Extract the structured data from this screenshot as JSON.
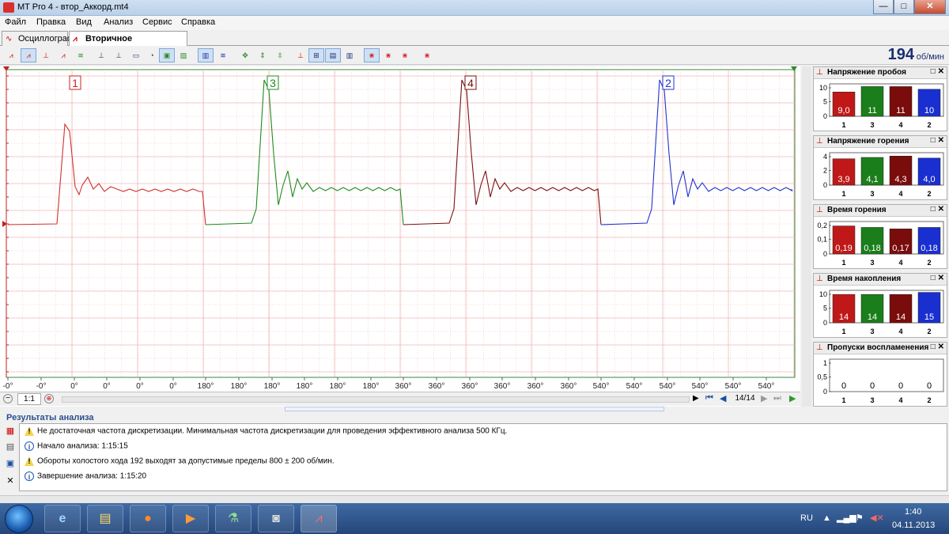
{
  "window": {
    "title": "MT Pro 4 - втор_Аккорд.mt4",
    "min": "—",
    "max": "□",
    "close": "✕"
  },
  "menu": [
    "Файл",
    "Правка",
    "Вид",
    "Анализ",
    "Сервис",
    "Справка"
  ],
  "tabs": [
    {
      "label": "Осциллограф",
      "icon": "oscilloscope-icon"
    },
    {
      "label": "Вторичное напряжение",
      "icon": "secondary-voltage-icon"
    }
  ],
  "rpm": {
    "value": "194",
    "unit": "об/мин"
  },
  "plot": {
    "cylinder_labels": [
      {
        "text": "1",
        "color": "#cc2222"
      },
      {
        "text": "3",
        "color": "#1f8a1f"
      },
      {
        "text": "4",
        "color": "#7a1010"
      },
      {
        "text": "2",
        "color": "#2233cc"
      }
    ],
    "x_ticks": [
      "-0°",
      "-0°",
      "0°",
      "0°",
      "0°",
      "0°",
      "180°",
      "180°",
      "180°",
      "180°",
      "180°",
      "180°",
      "360°",
      "360°",
      "360°",
      "360°",
      "360°",
      "360°",
      "540°",
      "540°",
      "540°",
      "540°",
      "540°",
      "540°"
    ],
    "zoom": "1:1",
    "page": "14/14"
  },
  "panels": [
    {
      "title": "Напряжение пробоя",
      "yticks": [
        "10",
        "5",
        "0"
      ],
      "ymax": 12,
      "bars": [
        {
          "cyl": "1",
          "value": 9.0,
          "label": "9,0",
          "color": "#c01818"
        },
        {
          "cyl": "3",
          "value": 11,
          "label": "11",
          "color": "#1a7f1a"
        },
        {
          "cyl": "4",
          "value": 11,
          "label": "11",
          "color": "#7a0c0c"
        },
        {
          "cyl": "2",
          "value": 10,
          "label": "10",
          "color": "#1a2fd0"
        }
      ]
    },
    {
      "title": "Напряжение горения",
      "yticks": [
        "4",
        "2",
        "0"
      ],
      "ymax": 4.8,
      "bars": [
        {
          "cyl": "1",
          "value": 3.9,
          "label": "3,9",
          "color": "#c01818"
        },
        {
          "cyl": "3",
          "value": 4.1,
          "label": "4,1",
          "color": "#1a7f1a"
        },
        {
          "cyl": "4",
          "value": 4.3,
          "label": "4,3",
          "color": "#7a0c0c"
        },
        {
          "cyl": "2",
          "value": 4.0,
          "label": "4,0",
          "color": "#1a2fd0"
        }
      ]
    },
    {
      "title": "Время горения",
      "yticks": [
        "0,2",
        "0,1",
        "0"
      ],
      "ymax": 0.22,
      "bars": [
        {
          "cyl": "1",
          "value": 0.19,
          "label": "0,19",
          "color": "#c01818"
        },
        {
          "cyl": "3",
          "value": 0.18,
          "label": "0,18",
          "color": "#1a7f1a"
        },
        {
          "cyl": "4",
          "value": 0.17,
          "label": "0,17",
          "color": "#7a0c0c"
        },
        {
          "cyl": "2",
          "value": 0.18,
          "label": "0,18",
          "color": "#1a2fd0"
        }
      ]
    },
    {
      "title": "Время накопления",
      "yticks": [
        "10",
        "5",
        "0"
      ],
      "ymax": 16,
      "bars": [
        {
          "cyl": "1",
          "value": 14,
          "label": "14",
          "color": "#c01818"
        },
        {
          "cyl": "3",
          "value": 14,
          "label": "14",
          "color": "#1a7f1a"
        },
        {
          "cyl": "4",
          "value": 14,
          "label": "14",
          "color": "#7a0c0c"
        },
        {
          "cyl": "2",
          "value": 15,
          "label": "15",
          "color": "#1a2fd0"
        }
      ]
    },
    {
      "title": "Пропуски воспламенения",
      "yticks": [
        "1",
        "0,5",
        "0"
      ],
      "ymax": 1,
      "bars": [
        {
          "cyl": "1",
          "value": 0,
          "label": "0",
          "color": "#888888"
        },
        {
          "cyl": "3",
          "value": 0,
          "label": "0",
          "color": "#888888"
        },
        {
          "cyl": "4",
          "value": 0,
          "label": "0",
          "color": "#888888"
        },
        {
          "cyl": "2",
          "value": 0,
          "label": "0",
          "color": "#888888"
        }
      ]
    }
  ],
  "results": {
    "title": "Результаты анализа",
    "messages": [
      {
        "type": "warn",
        "text": "Не достаточная частота дискретизации. Минимальная частота дискретизации для проведения эффективного анализа 500 КГц."
      },
      {
        "type": "info",
        "text": "Начало анализа: 1:15:15"
      },
      {
        "type": "warn",
        "text": "Обороты холостого хода 192 выходят за допустимые пределы 800 ± 200 об/мин."
      },
      {
        "type": "info",
        "text": "Завершение анализа: 1:15:20"
      }
    ]
  },
  "taskbar": {
    "lang": "RU",
    "time": "1:40",
    "date": "04.11.2013"
  }
}
